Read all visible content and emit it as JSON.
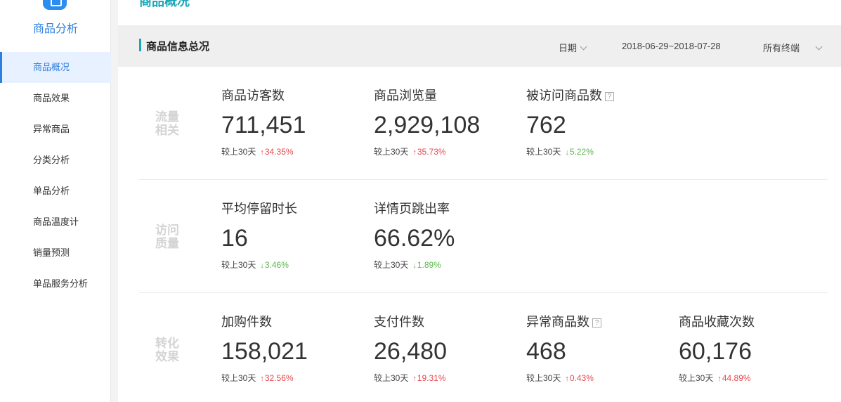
{
  "sidebar": {
    "title": "商品分析",
    "items": [
      {
        "label": "商品概况"
      },
      {
        "label": "商品效果"
      },
      {
        "label": "异常商品"
      },
      {
        "label": "分类分析"
      },
      {
        "label": "单品分析"
      },
      {
        "label": "商品温度计"
      },
      {
        "label": "销量预测"
      },
      {
        "label": "单品服务分析"
      }
    ]
  },
  "page": {
    "title": "商品概况"
  },
  "section": {
    "title": "商品信息总况",
    "filters": {
      "date_label": "日期",
      "date_range": "2018-06-29~2018-07-28",
      "terminal": "所有终端"
    }
  },
  "colors": {
    "up": "#e8484f",
    "down": "#5ab749",
    "accent": "#1aa6b8"
  },
  "groups": [
    {
      "label": "流量相关",
      "metrics": [
        {
          "label": "商品访客数",
          "value": "711,451",
          "compare": "较上30天",
          "change": "34.35%",
          "direction": "up",
          "help": false
        },
        {
          "label": "商品浏览量",
          "value": "2,929,108",
          "compare": "较上30天",
          "change": "35.73%",
          "direction": "up",
          "help": false
        },
        {
          "label": "被访问商品数",
          "value": "762",
          "compare": "较上30天",
          "change": "5.22%",
          "direction": "down",
          "help": true
        }
      ]
    },
    {
      "label": "访问质量",
      "metrics": [
        {
          "label": "平均停留时长",
          "value": "16",
          "compare": "较上30天",
          "change": "3.46%",
          "direction": "down",
          "help": false
        },
        {
          "label": "详情页跳出率",
          "value": "66.62%",
          "compare": "较上30天",
          "change": "1.89%",
          "direction": "down",
          "help": false
        }
      ]
    },
    {
      "label": "转化效果",
      "metrics": [
        {
          "label": "加购件数",
          "value": "158,021",
          "compare": "较上30天",
          "change": "32.56%",
          "direction": "up",
          "help": false
        },
        {
          "label": "支付件数",
          "value": "26,480",
          "compare": "较上30天",
          "change": "19.31%",
          "direction": "up",
          "help": false
        },
        {
          "label": "异常商品数",
          "value": "468",
          "compare": "较上30天",
          "change": "0.43%",
          "direction": "up",
          "help": true
        },
        {
          "label": "商品收藏次数",
          "value": "60,176",
          "compare": "较上30天",
          "change": "44.89%",
          "direction": "up",
          "help": false
        }
      ]
    }
  ]
}
